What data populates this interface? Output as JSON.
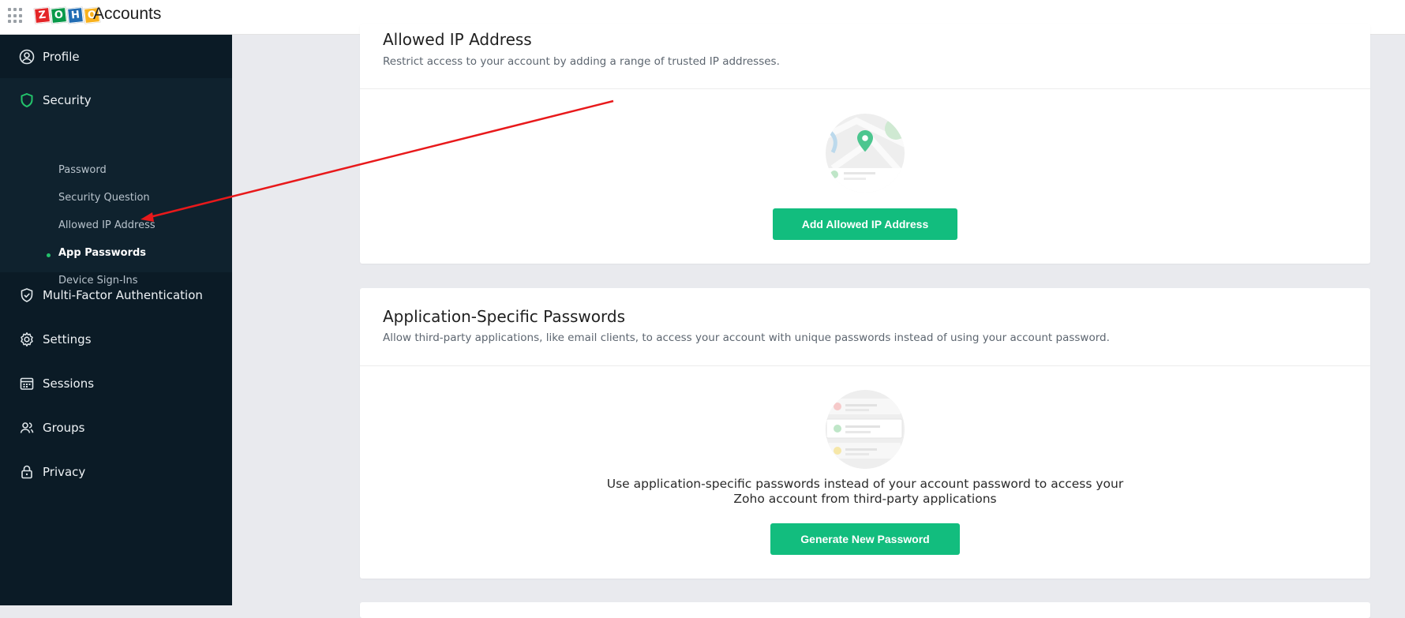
{
  "header": {
    "app_title": "Accounts",
    "logo_letters": [
      {
        "char": "Z",
        "color": "#e42527"
      },
      {
        "char": "O",
        "color": "#089949"
      },
      {
        "char": "H",
        "color": "#226db4"
      },
      {
        "char": "O",
        "color": "#f9b21d"
      }
    ]
  },
  "sidebar": {
    "items": {
      "profile": "Profile",
      "security": "Security",
      "mfa": "Multi-Factor Authentication",
      "settings": "Settings",
      "sessions": "Sessions",
      "groups": "Groups",
      "privacy": "Privacy"
    },
    "security_sub": {
      "password": "Password",
      "security_question": "Security Question",
      "allowed_ip": "Allowed IP Address",
      "app_passwords": "App Passwords",
      "device_signins": "Device Sign-Ins"
    },
    "active_sub": "App Passwords"
  },
  "allowed_ip": {
    "title": "Allowed IP Address",
    "description": "Restrict access to your account by adding a range of trusted IP addresses.",
    "button": "Add Allowed IP Address"
  },
  "app_passwords": {
    "title": "Application-Specific Passwords",
    "description": "Allow third-party applications, like email clients, to access your account with unique passwords instead of using your account password.",
    "empty_line1": "Use application-specific passwords instead of your account password to access your",
    "empty_line2": "Zoho account from third-party applications",
    "button": "Generate New Password"
  },
  "colors": {
    "accent_green": "#12bd7e",
    "sidebar_bg": "#0b1b26",
    "annotation_arrow": "#e8191b"
  }
}
